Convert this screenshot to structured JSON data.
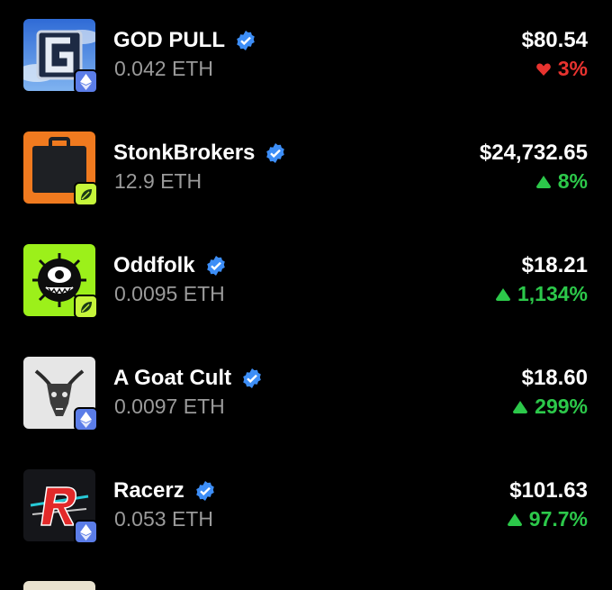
{
  "collections": [
    {
      "name": "GOD PULL",
      "floor": "0.042 ETH",
      "usd": "$80.54",
      "change": "3%",
      "direction": "down",
      "chain": "eth-icon",
      "thumb": "god-pull",
      "verified": true
    },
    {
      "name": "StonkBrokers",
      "floor": "12.9 ETH",
      "usd": "$24,732.65",
      "change": "8%",
      "direction": "up",
      "chain": "leaf-icon",
      "thumb": "briefcase",
      "verified": true
    },
    {
      "name": "Oddfolk",
      "floor": "0.0095 ETH",
      "usd": "$18.21",
      "change": "1,134%",
      "direction": "up",
      "chain": "leaf-icon",
      "thumb": "eye-creature",
      "verified": true
    },
    {
      "name": "A Goat Cult",
      "floor": "0.0097 ETH",
      "usd": "$18.60",
      "change": "299%",
      "direction": "up",
      "chain": "eth-icon",
      "thumb": "goat-skull",
      "verified": true
    },
    {
      "name": "Racerz",
      "floor": "0.053 ETH",
      "usd": "$101.63",
      "change": "97.7%",
      "direction": "up",
      "chain": "eth-icon",
      "thumb": "racer-r",
      "verified": true
    }
  ],
  "colors": {
    "up": "#2cc84a",
    "down": "#e8332f",
    "verified": "#3d8ef7",
    "muted": "#9a9a9a"
  }
}
